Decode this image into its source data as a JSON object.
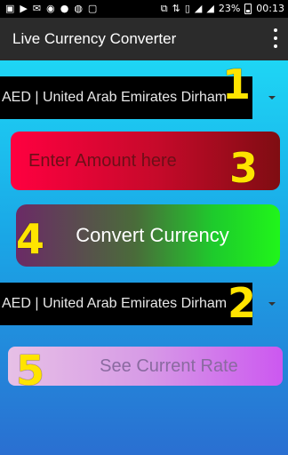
{
  "status_bar": {
    "battery": "23%",
    "time": "00:13",
    "icons_left": [
      "photo-icon",
      "youtube-icon",
      "mail-icon",
      "disc-icon",
      "record-icon",
      "messenger-icon",
      "app-icon"
    ],
    "icons_right": [
      "cast-icon",
      "data-icon",
      "vibrate-icon",
      "signal-icon",
      "signal-icon-2",
      "battery-icon"
    ]
  },
  "app_bar": {
    "title": "Live Currency Converter"
  },
  "from_currency": {
    "selected": "AED | United Arab Emirates Dirham"
  },
  "to_currency": {
    "selected": "AED | United Arab Emirates Dirham"
  },
  "amount_input": {
    "placeholder": "Enter Amount here"
  },
  "buttons": {
    "convert_label": "Convert Currency",
    "rate_label": "See Current Rate"
  },
  "annotations": {
    "n1": "1",
    "n2": "2",
    "n3": "3",
    "n4": "4",
    "n5": "5"
  },
  "colors": {
    "annotation": "#ffe400",
    "appbar": "#2b2b2b"
  }
}
